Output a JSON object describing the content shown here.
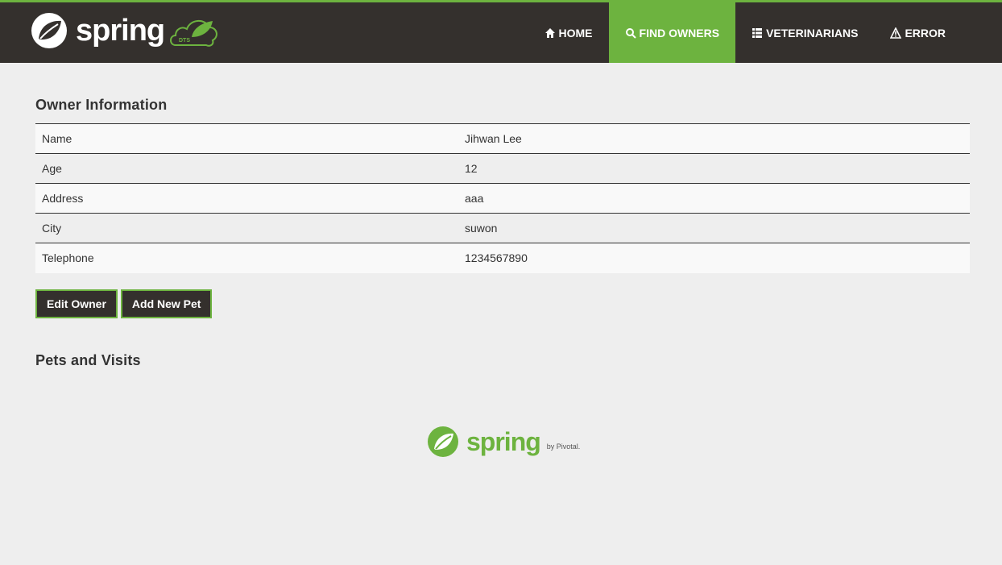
{
  "brand": {
    "wordmark": "spring",
    "badge": "DTS"
  },
  "nav": {
    "items": [
      {
        "label": "Home",
        "icon": "home-icon",
        "active": false
      },
      {
        "label": "Find owners",
        "icon": "search-icon",
        "active": true
      },
      {
        "label": "Veterinarians",
        "icon": "list-icon",
        "active": false
      },
      {
        "label": "Error",
        "icon": "warning-icon",
        "active": false
      }
    ]
  },
  "owner": {
    "title": "Owner Information",
    "rows": [
      {
        "label": "Name",
        "value": "Jihwan Lee"
      },
      {
        "label": "Age",
        "value": "12"
      },
      {
        "label": "Address",
        "value": "aaa"
      },
      {
        "label": "City",
        "value": "suwon"
      },
      {
        "label": "Telephone",
        "value": "1234567890"
      }
    ],
    "edit_label": "Edit Owner",
    "add_pet_label": "Add New Pet"
  },
  "pets": {
    "title": "Pets and Visits"
  },
  "footer": {
    "wordmark": "spring",
    "by": "by Pivotal."
  },
  "colors": {
    "accent": "#6db33f",
    "dark": "#34302d",
    "background": "#eeeeee"
  }
}
